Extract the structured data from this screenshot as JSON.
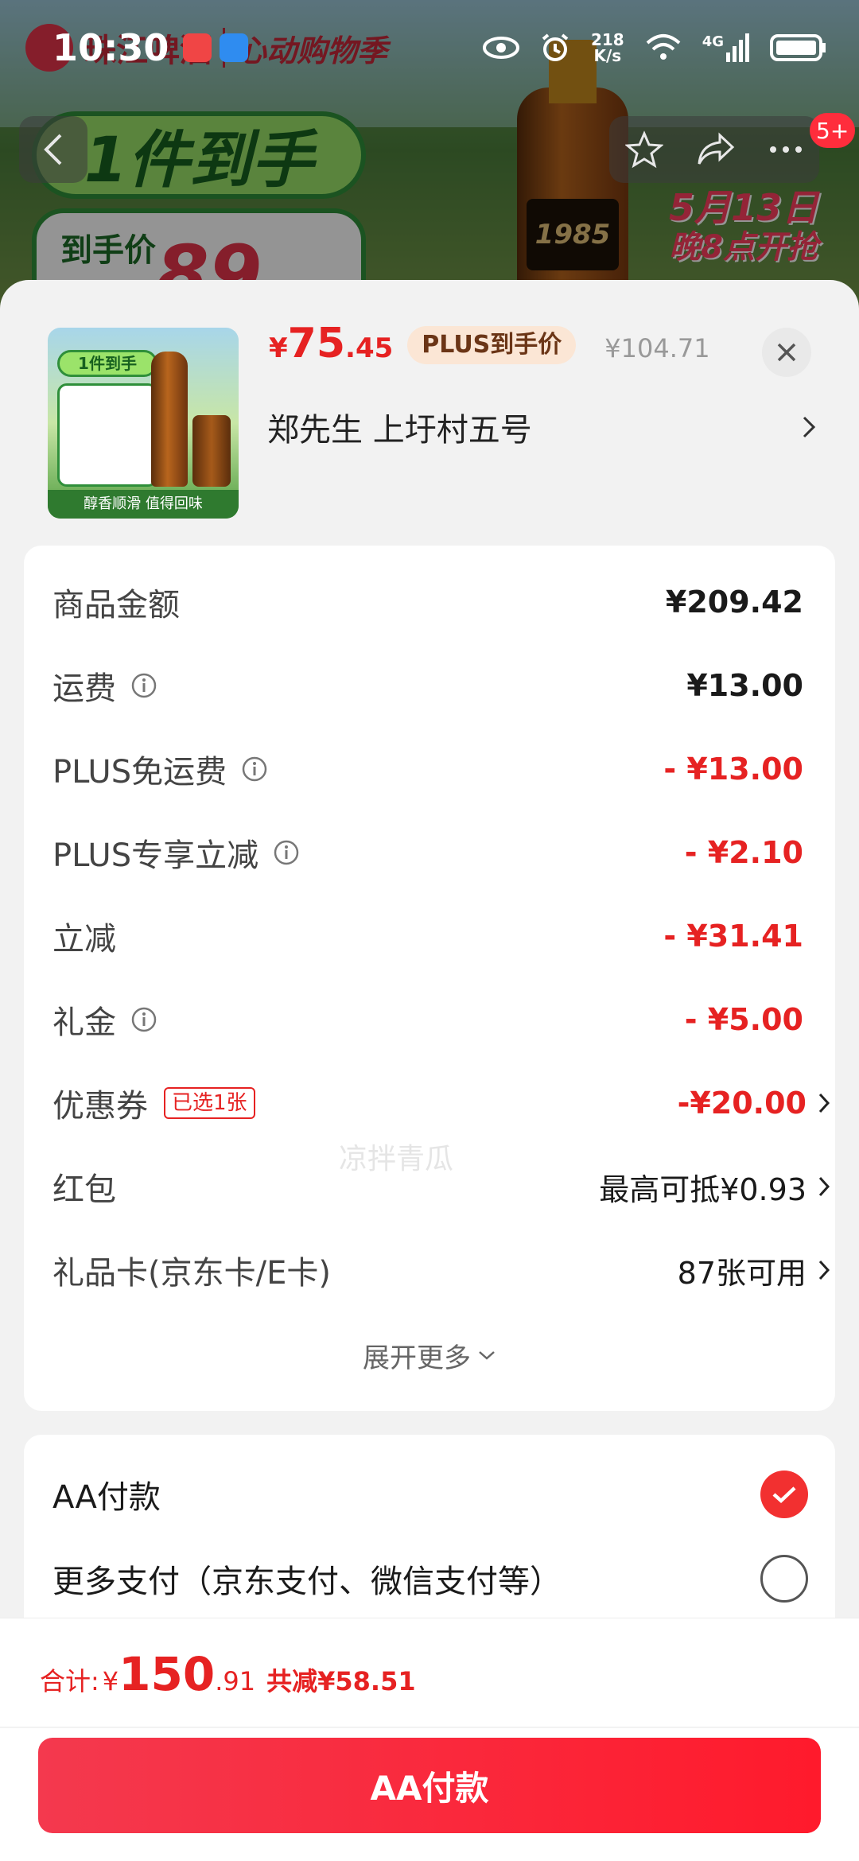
{
  "status_bar": {
    "time": "10:30",
    "net_speed": "218",
    "net_unit": "K/s",
    "signal": "4G"
  },
  "background": {
    "brand": "珠江啤酒",
    "campaign": "心动购物季",
    "banner": "1件到手",
    "price_label": "到手价",
    "price_fragment": "89",
    "bottle_label": "1985",
    "date_line1": "5月13日",
    "date_line2": "晚8点开抢",
    "badge": "5+"
  },
  "product": {
    "price_currency": "¥",
    "price_integer": "75",
    "price_decimal": ".45",
    "plus_tag": "PLUS到手价",
    "original_price": "¥104.71",
    "address": "郑先生  上圩村五号",
    "thumb_banner": "1件到手",
    "thumb_footer": "醇香顺滑 值得回味"
  },
  "details": {
    "rows": [
      {
        "label": "商品金额",
        "value": "¥209.42"
      },
      {
        "label": "运费",
        "value": "¥13.00"
      },
      {
        "label": "PLUS免运费",
        "value": "- ¥13.00"
      },
      {
        "label": "PLUS专享立减",
        "value": "- ¥2.10"
      },
      {
        "label": "立减",
        "value": "- ¥31.41"
      },
      {
        "label": "礼金",
        "value": "- ¥5.00"
      },
      {
        "label": "优惠券",
        "value": "-¥20.00",
        "tag": "已选1张"
      },
      {
        "label": "红包",
        "value": "最高可抵¥0.93"
      },
      {
        "label": "礼品卡(京东卡/E卡)",
        "value": "87张可用"
      }
    ],
    "expand_label": "展开更多",
    "watermark": "凉拌青瓜"
  },
  "payment": {
    "options": [
      {
        "label": "AA付款",
        "selected": true
      },
      {
        "label": "更多支付（京东支付、微信支付等）",
        "selected": false
      }
    ]
  },
  "footer": {
    "total_label": "合计:",
    "total_currency": "¥",
    "total_integer": "150",
    "total_decimal": ".91",
    "saved": "共减¥58.51",
    "pay_button": "AA付款"
  },
  "colors": {
    "accent_red": "#e62222",
    "button_red": "#ff1a2c",
    "plus_tag_bg": "#fbe6d5"
  }
}
